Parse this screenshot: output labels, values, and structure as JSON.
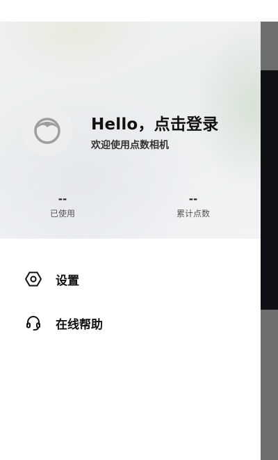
{
  "header": {
    "title": "Hello，点击登录",
    "subtitle": "欢迎使用点数相机"
  },
  "stats": [
    {
      "value": "--",
      "label": "已使用"
    },
    {
      "value": "--",
      "label": "累计点数"
    }
  ],
  "menu": {
    "items": [
      {
        "label": "设置",
        "icon": "hexagon-settings-icon"
      },
      {
        "label": "在线帮助",
        "icon": "headset-icon"
      }
    ]
  },
  "colors": {
    "drawer_background": "#ffffff",
    "header_background": "#eef0f1",
    "avatar_background": "#eeeeee",
    "avatar_icon": "#9e9e9e",
    "text_primary": "#111111",
    "scrim": "#6e6e6e"
  }
}
